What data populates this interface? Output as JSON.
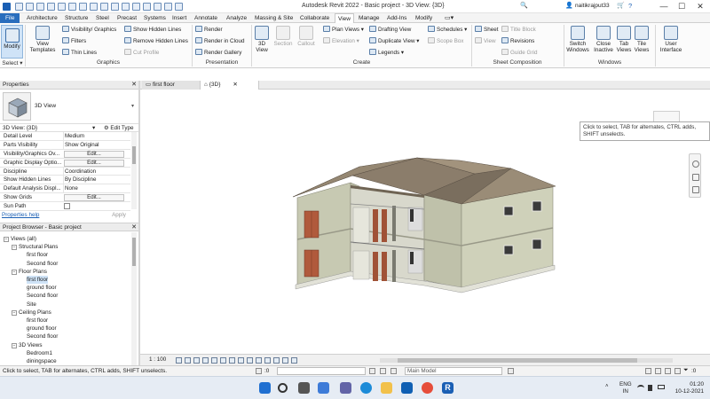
{
  "titlebar": {
    "title": "Autodesk Revit 2022 - Basic project - 3D View: {3D}",
    "username": "naitikrajput33",
    "search_symbol": "🔍",
    "user_icon_symbol": "👤",
    "cart_symbol": "🛒",
    "help_symbol": "?",
    "minimize_symbol": "—",
    "maximize_symbol": "☐",
    "close_symbol": "✕"
  },
  "ribbon_tabs": [
    "File",
    "Architecture",
    "Structure",
    "Steel",
    "Precast",
    "Systems",
    "Insert",
    "Annotate",
    "Analyze",
    "Massing & Site",
    "Collaborate",
    "View",
    "Manage",
    "Add-Ins",
    "Modify"
  ],
  "active_tab": "View",
  "ribbon": {
    "modify_label": "Modify",
    "select_label": "Select ▾",
    "view_templates_label": "View Templates",
    "visibility_graphics": "Visibility/ Graphics",
    "filters": "Filters",
    "thin_lines": "Thin Lines",
    "show_hidden_lines": "Show Hidden Lines",
    "remove_hidden_lines": "Remove Hidden Lines",
    "cut_profile": "Cut Profile",
    "graphics_panel": "Graphics",
    "render": "Render",
    "render_in_cloud": "Render in Cloud",
    "render_gallery": "Render Gallery",
    "presentation_panel": "Presentation",
    "view_3d": "3D View",
    "section": "Section",
    "callout": "Callout",
    "plan_views": "Plan Views ▾",
    "elevation": "Elevation ▾",
    "drafting_view": "Drafting View",
    "duplicate_view": "Duplicate View ▾",
    "legends": "Legends ▾",
    "schedules": "Schedules ▾",
    "scope_box": "Scope Box",
    "create_panel": "Create",
    "sheet": "Sheet",
    "title_block": "Title Block",
    "view": "View",
    "revisions": "Revisions",
    "guide_grid": "Guide Grid",
    "sheet_composition_panel": "Sheet Composition",
    "switch_windows": "Switch Windows",
    "close_inactive": "Close Inactive",
    "tab_views": "Tab Views",
    "tile_views": "Tile Views",
    "windows_panel": "Windows",
    "user_interface": "User Interface"
  },
  "properties": {
    "title": "Properties",
    "type_name": "3D View",
    "instance": "3D View: {3D}",
    "edit_type": "Edit Type",
    "rows": [
      {
        "key": "Detail Level",
        "value": "Medium",
        "kind": "text"
      },
      {
        "key": "Parts Visibility",
        "value": "Show Original",
        "kind": "text"
      },
      {
        "key": "Visibility/Graphics Ov...",
        "value": "Edit...",
        "kind": "button"
      },
      {
        "key": "Graphic Display Optio...",
        "value": "Edit...",
        "kind": "button"
      },
      {
        "key": "Discipline",
        "value": "Coordination",
        "kind": "text"
      },
      {
        "key": "Show Hidden Lines",
        "value": "By Discipline",
        "kind": "text"
      },
      {
        "key": "Default Analysis Displ...",
        "value": "None",
        "kind": "text"
      },
      {
        "key": "Show Grids",
        "value": "Edit...",
        "kind": "button"
      },
      {
        "key": "Sun Path",
        "value": "",
        "kind": "checkbox"
      }
    ],
    "help_link": "Properties help",
    "apply": "Apply"
  },
  "project_browser": {
    "title": "Project Browser - Basic project",
    "items": [
      {
        "label": "Views (all)",
        "level": 0,
        "toggle": "−"
      },
      {
        "label": "Structural Plans",
        "level": 1,
        "toggle": "−"
      },
      {
        "label": "first floor",
        "level": 2,
        "toggle": ""
      },
      {
        "label": "Second floor",
        "level": 2,
        "toggle": ""
      },
      {
        "label": "Floor Plans",
        "level": 1,
        "toggle": "−"
      },
      {
        "label": "first floor",
        "level": 2,
        "toggle": "",
        "selected": true
      },
      {
        "label": "ground floor",
        "level": 2,
        "toggle": ""
      },
      {
        "label": "Second floor",
        "level": 2,
        "toggle": ""
      },
      {
        "label": "Site",
        "level": 2,
        "toggle": ""
      },
      {
        "label": "Ceiling Plans",
        "level": 1,
        "toggle": "−"
      },
      {
        "label": "first floor",
        "level": 2,
        "toggle": ""
      },
      {
        "label": "ground floor",
        "level": 2,
        "toggle": ""
      },
      {
        "label": "Second floor",
        "level": 2,
        "toggle": ""
      },
      {
        "label": "3D Views",
        "level": 1,
        "toggle": "−"
      },
      {
        "label": "Bedroom1",
        "level": 2,
        "toggle": ""
      },
      {
        "label": "diningspace",
        "level": 2,
        "toggle": ""
      }
    ]
  },
  "view_tabs": [
    {
      "label": "first floor",
      "active": false
    },
    {
      "label": "{3D}",
      "active": true
    }
  ],
  "canvas": {
    "tooltip": "Click to select, TAB for alternates, CTRL adds, SHIFT unselects."
  },
  "view_control": {
    "scale": "1 : 100"
  },
  "statusbar": {
    "text": "Click to select, TAB for alternates, CTRL adds, SHIFT unselects.",
    "workset": ":0",
    "model": "Main Model",
    "filter_count": ":0"
  },
  "taskbar": {
    "lang1": "ENG",
    "lang2": "IN",
    "time": "01:20",
    "date": "10-12-2021"
  },
  "colors": {
    "accent": "#2a6ebd",
    "roof": "#8b7d6b",
    "wall": "#c9cbb4",
    "door": "#b05a3c"
  }
}
